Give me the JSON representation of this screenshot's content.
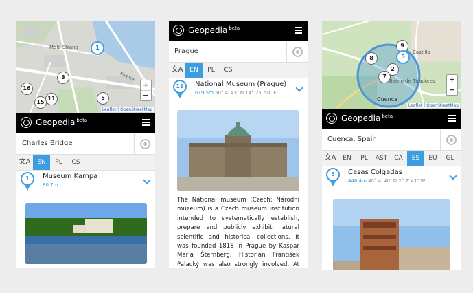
{
  "app": {
    "name": "Geopedia",
    "beta": "beta"
  },
  "map": {
    "attribution": "Leaflet | OpenStreetMap",
    "zoom_in": "+",
    "zoom_out": "−"
  },
  "phone1": {
    "map_labels": [
      "Malá Strana",
      "Karlova"
    ],
    "pins": [
      "1",
      "3",
      "16",
      "11",
      "15",
      "5"
    ],
    "search_value": "Charles Bridge",
    "langs": [
      "EN",
      "PL",
      "CS"
    ],
    "active_lang": "EN",
    "result": {
      "number": "1",
      "title": "Museum Kampa",
      "distance": "80.7m"
    }
  },
  "phone2": {
    "search_value": "Prague",
    "langs": [
      "EN",
      "PL",
      "CS"
    ],
    "active_lang": "EN",
    "result": {
      "number": "11",
      "title": "National Museum (Prague)",
      "distance": "619.5m",
      "coords": "50° 4′ 43″ N 14° 25′ 50″ E"
    },
    "description": "The National museum (Czech: Národní muzeum) is a Czech museum institution intended to systematically establish, prepare and publicly exhibit natural scientific and historical collections. It was founded 1818 in Prague by Kašpar Maria Šternberg. Historian František Palacký was also strongly involved. At present the"
  },
  "phone3": {
    "map_labels": [
      "Cuenca",
      "Castillo",
      "Barrio de Tiradores"
    ],
    "pins": [
      "9",
      "5",
      "8",
      "2",
      "7"
    ],
    "search_value": "Cuenca, Spain",
    "langs": [
      "EN",
      "PL",
      "AST",
      "CA",
      "ES",
      "EU",
      "GL"
    ],
    "active_lang": "ES",
    "result": {
      "number": "5",
      "title": "Casas Colgadas",
      "distance": "446.4m",
      "coords": "40° 4′ 40″ N 2° 7′ 41″ W"
    }
  },
  "colors": {
    "accent": "#3d9de0",
    "header": "#000000"
  }
}
